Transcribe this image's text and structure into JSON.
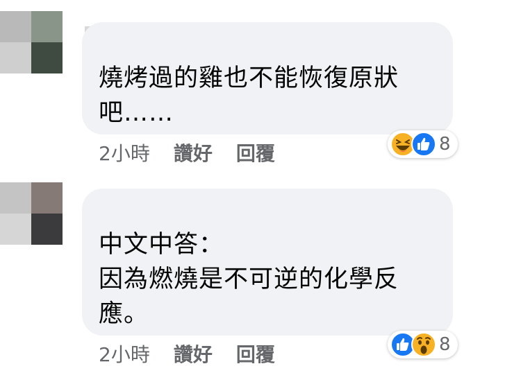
{
  "comments": [
    {
      "text": "燒烤過的雞也不能恢復原狀\n吧……",
      "time": "2小時",
      "like_label": "讚好",
      "reply_label": "回覆",
      "reactions": [
        "haha",
        "like"
      ],
      "reaction_count": "8"
    },
    {
      "text": "中文中答：\n因為燃燒是不可逆的化學反\n應。",
      "time": "2小時",
      "like_label": "讚好",
      "reply_label": "回覆",
      "reactions": [
        "like",
        "wow"
      ],
      "reaction_count": "8"
    }
  ],
  "colors": {
    "bubble": "#f0f2f5",
    "secondary_text": "#65676b",
    "like_blue": "#1877f2",
    "emoji_yellow": "#f7b125"
  }
}
